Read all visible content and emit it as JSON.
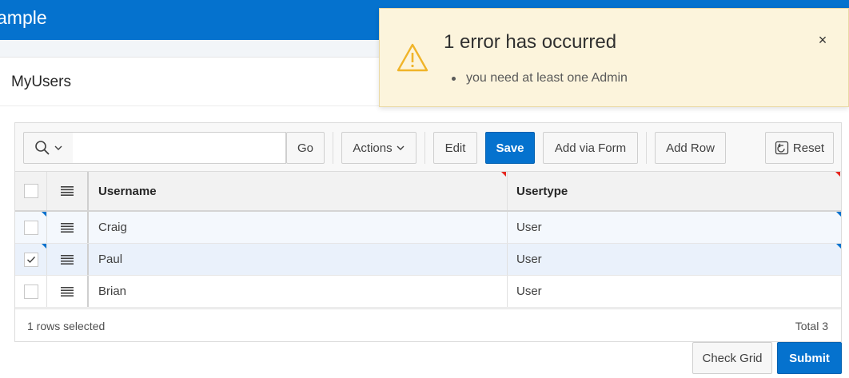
{
  "app": {
    "title": "ample"
  },
  "region": {
    "title": "MyUsers"
  },
  "toolbar": {
    "search_placeholder": "",
    "go_label": "Go",
    "actions_label": "Actions",
    "edit_label": "Edit",
    "save_label": "Save",
    "add_via_form_label": "Add via Form",
    "add_row_label": "Add Row",
    "reset_label": "Reset"
  },
  "grid": {
    "columns": [
      "Username",
      "Usertype"
    ],
    "rows": [
      {
        "username": "Craig",
        "usertype": "User",
        "selected": false
      },
      {
        "username": "Paul",
        "usertype": "User",
        "selected": true
      },
      {
        "username": "Brian",
        "usertype": "User",
        "selected": false
      }
    ],
    "footer": {
      "selected_text": "1 rows selected",
      "total_text": "Total 3"
    }
  },
  "page_buttons": {
    "check_grid": "Check Grid",
    "submit": "Submit"
  },
  "notification": {
    "title": "1 error has occurred",
    "messages": [
      "you need at least one Admin"
    ],
    "close_glyph": "×"
  },
  "colors": {
    "brand": "#0572ce",
    "warning_bg": "#fcf4dc",
    "warning_icon": "#f0b429",
    "selected_row": "#eaf1fb",
    "changed_marker": "#0572ce",
    "error_marker": "#e5261f"
  }
}
